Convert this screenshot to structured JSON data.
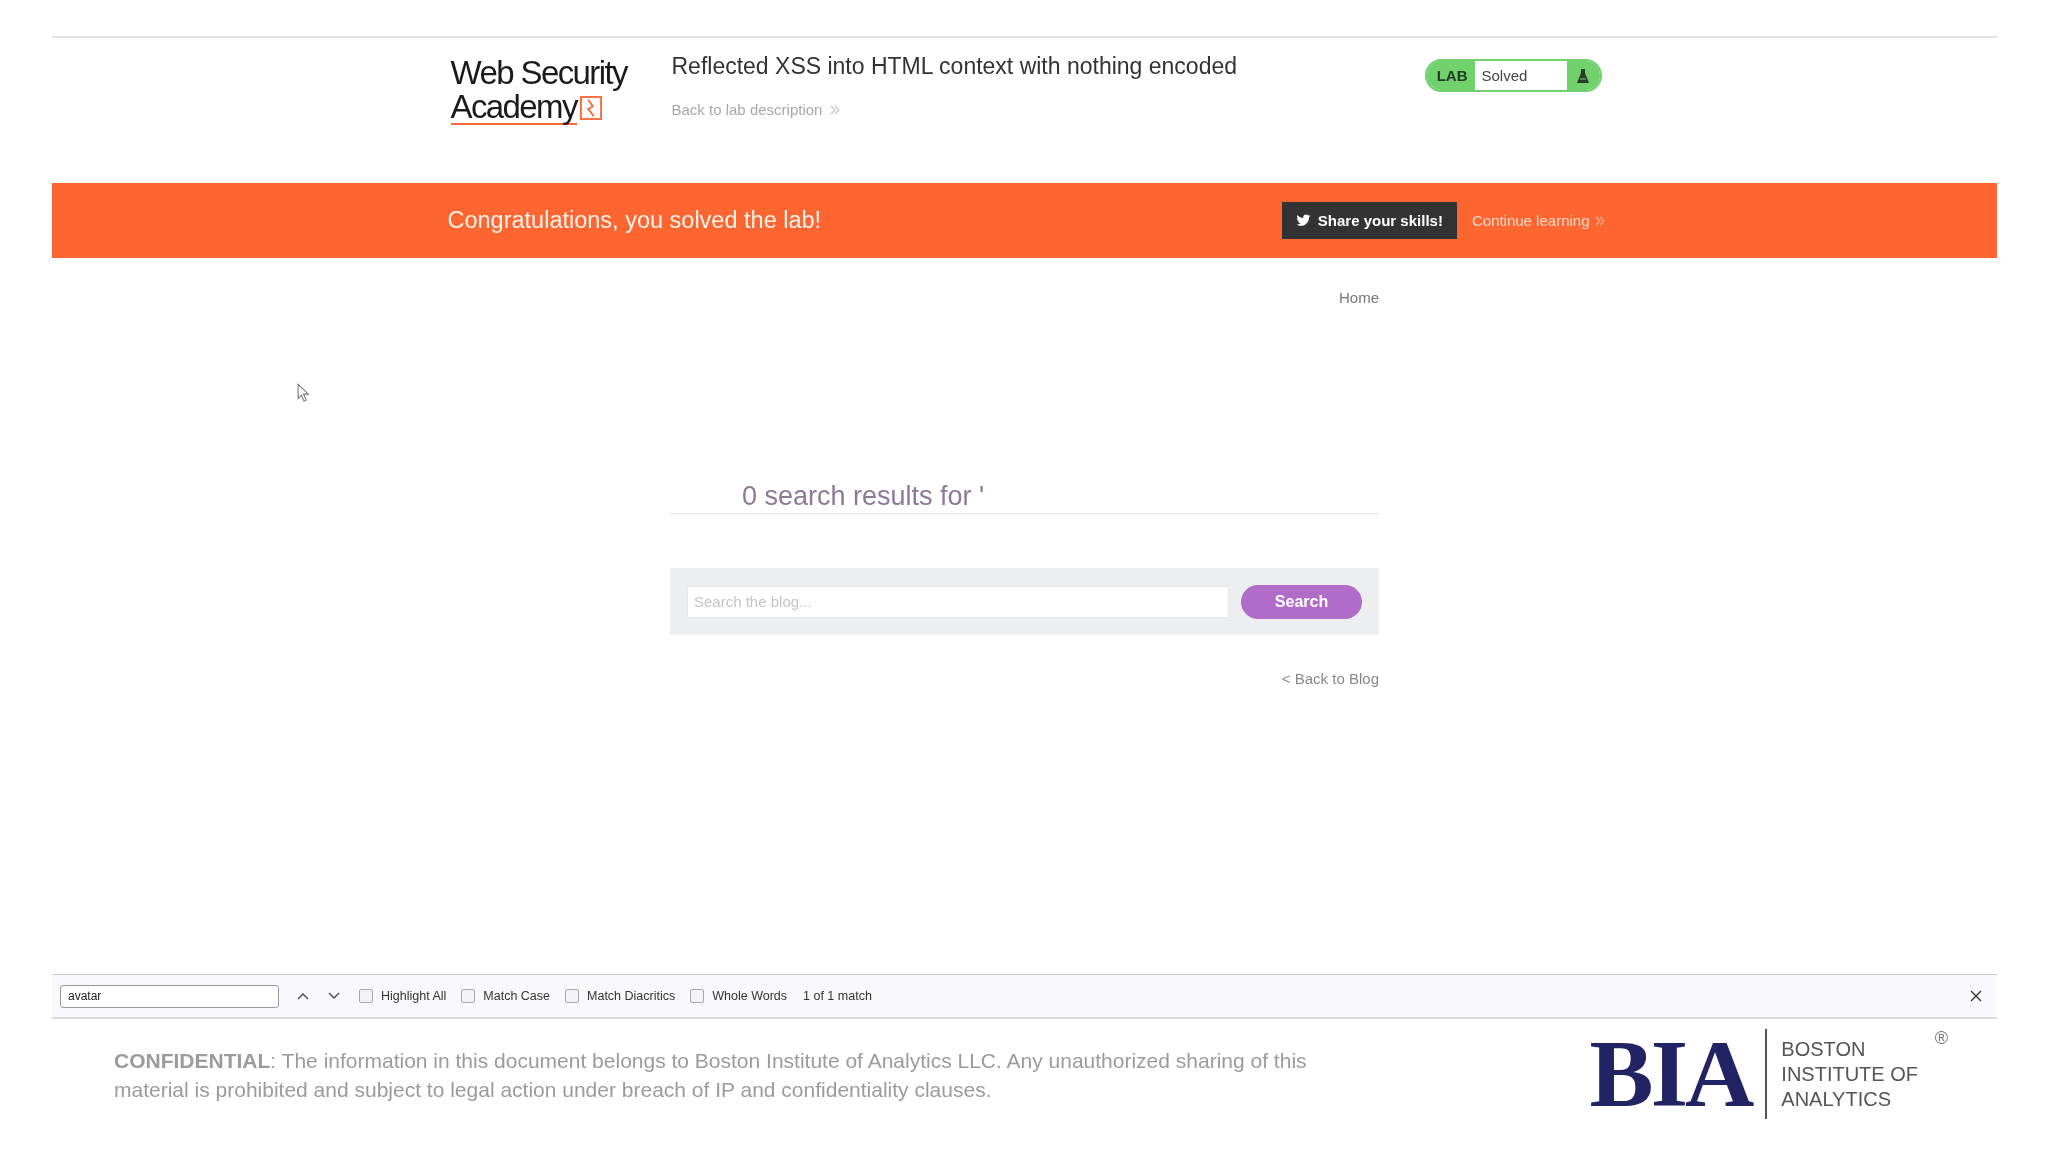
{
  "header": {
    "logo": {
      "lines": [
        "Web Security",
        "Academy"
      ]
    },
    "lab_title": "Reflected XSS into HTML context with nothing encoded",
    "back_link": "Back to lab description",
    "lab_status": {
      "tag": "LAB",
      "status": "Solved",
      "solved": true
    }
  },
  "banner": {
    "message": "Congratulations, you solved the lab!",
    "share_button": "Share your skills!",
    "continue_link": "Continue learning"
  },
  "nav": {
    "links": [
      "Home"
    ]
  },
  "search_results": {
    "heading": "0 search results for '",
    "search_field": {
      "placeholder": "Search the blog..."
    },
    "search_button": "Search",
    "back_link": "< Back to Blog"
  },
  "find_bar": {
    "query": "avatar",
    "options": [
      {
        "label": "Highlight All",
        "checked": false
      },
      {
        "label": "Match Case",
        "checked": false
      },
      {
        "label": "Match Diacritics",
        "checked": false
      },
      {
        "label": "Whole Words",
        "checked": false
      }
    ],
    "match_count": "1 of 1 match"
  },
  "slide_footer": {
    "notice": "**CONFIDENTIAL**: The information in this document belongs to Boston Institute of Analytics LLC. Any unauthorized sharing of this material is prohibited and subject to legal action under breach of IP and confidentiality clauses.",
    "brand": {
      "initials": "BIA",
      "name_lines": [
        "BOSTON",
        "INSTITUTE OF",
        "ANALYTICS"
      ],
      "registered_mark": "®"
    }
  }
}
